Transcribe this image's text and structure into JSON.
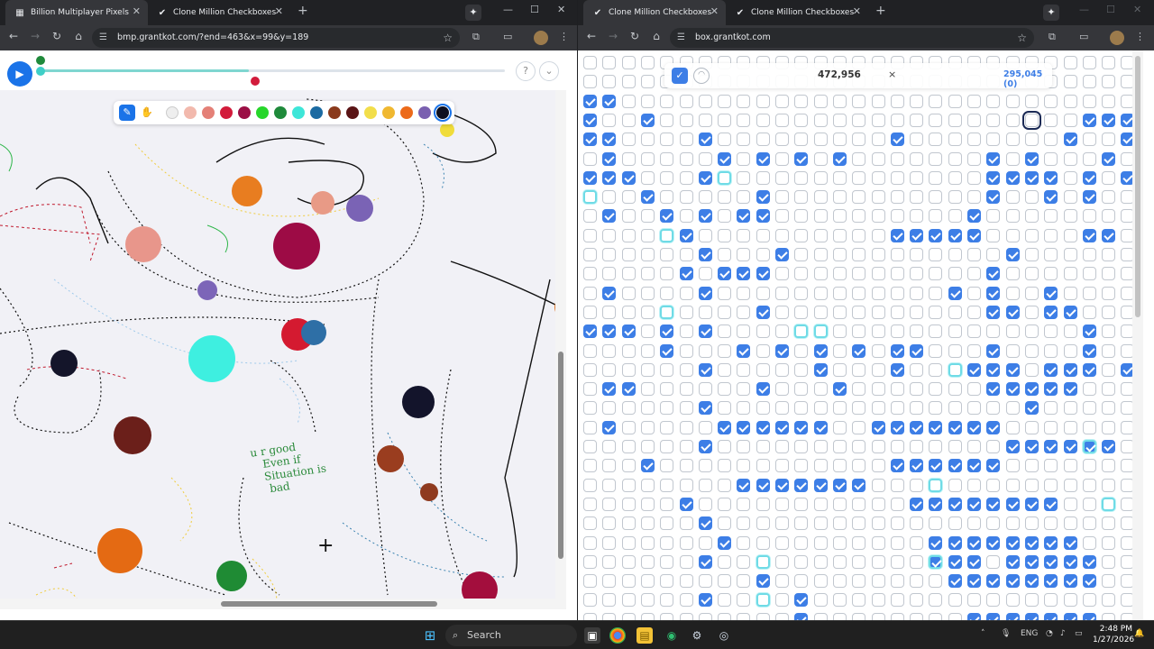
{
  "left_window": {
    "tabs": [
      {
        "label": "Billion Multiplayer Pixels",
        "active": true
      },
      {
        "label": "Clone Million Checkboxes",
        "active": false
      }
    ],
    "url": "bmp.grantkot.com/?end=463&x=99&y=189",
    "timeline_progress": 0.45,
    "palette": {
      "tools": [
        "pencil-icon",
        "hand-icon"
      ],
      "colors": [
        "#eeeeee",
        "#f2b9ad",
        "#e48077",
        "#d21b3b",
        "#9b0f45",
        "#27d62b",
        "#1f8a3b",
        "#3ee6d8",
        "#1b6aa2",
        "#8a3a1c",
        "#5a1416",
        "#f2de4b",
        "#f0b830",
        "#ec6a1a",
        "#7a60b0",
        "#0e0f1e"
      ],
      "selected_index": 15
    },
    "canvas": {
      "blobs": [
        {
          "color": "#f0dc3a",
          "note": "yellow"
        },
        {
          "color": "#e87d20"
        },
        {
          "color": "#e89a86"
        },
        {
          "color": "#7a63b5"
        },
        {
          "color": "#9d0b45"
        },
        {
          "color": "#e8968b"
        },
        {
          "color": "#7c65b8"
        },
        {
          "color": "#d41a30"
        },
        {
          "color": "#2e6fa6"
        },
        {
          "color": "#3eefe0"
        },
        {
          "color": "#14152a"
        },
        {
          "color": "#13142b"
        },
        {
          "color": "#6b1f1a"
        },
        {
          "color": "#9a3d1f"
        },
        {
          "color": "#8f3a1f"
        },
        {
          "color": "#e46a13"
        },
        {
          "color": "#1f8b34"
        },
        {
          "color": "#a30e3d"
        },
        {
          "color": "#e17a2c"
        }
      ],
      "graffiti": [
        "u r good",
        "Even if",
        "Situation is",
        "bad"
      ]
    }
  },
  "right_window": {
    "tabs": [
      {
        "label": "Clone Million Checkboxes",
        "active": true
      },
      {
        "label": "Clone Million Checkboxes",
        "active": false
      }
    ],
    "url": "box.grantkot.com",
    "count": "472,956",
    "close_label": "×",
    "score": "295,045 (0)",
    "grid": {
      "cols": 29,
      "rows": 31,
      "checked": [
        [
          6,
          28
        ],
        [
          2,
          0
        ],
        [
          2,
          1
        ],
        [
          3,
          0
        ],
        [
          3,
          3
        ],
        [
          3,
          26
        ],
        [
          3,
          27
        ],
        [
          3,
          28
        ],
        [
          4,
          0
        ],
        [
          4,
          1
        ],
        [
          4,
          6
        ],
        [
          4,
          16
        ],
        [
          4,
          25
        ],
        [
          4,
          28
        ],
        [
          5,
          1
        ],
        [
          5,
          7
        ],
        [
          5,
          9
        ],
        [
          5,
          11
        ],
        [
          5,
          13
        ],
        [
          5,
          21
        ],
        [
          5,
          23
        ],
        [
          5,
          27
        ],
        [
          6,
          0
        ],
        [
          6,
          1
        ],
        [
          6,
          2
        ],
        [
          6,
          6
        ],
        [
          6,
          21
        ],
        [
          6,
          22
        ],
        [
          6,
          23
        ],
        [
          6,
          24
        ],
        [
          6,
          26
        ],
        [
          7,
          3
        ],
        [
          7,
          9
        ],
        [
          7,
          21
        ],
        [
          7,
          24
        ],
        [
          7,
          26
        ],
        [
          8,
          1
        ],
        [
          8,
          4
        ],
        [
          8,
          6
        ],
        [
          8,
          8
        ],
        [
          8,
          9
        ],
        [
          8,
          20
        ],
        [
          9,
          5
        ],
        [
          9,
          16
        ],
        [
          9,
          17
        ],
        [
          9,
          18
        ],
        [
          9,
          19
        ],
        [
          9,
          20
        ],
        [
          9,
          26
        ],
        [
          9,
          27
        ],
        [
          10,
          6
        ],
        [
          10,
          10
        ],
        [
          10,
          22
        ],
        [
          11,
          5
        ],
        [
          11,
          7
        ],
        [
          11,
          8
        ],
        [
          11,
          9
        ],
        [
          11,
          21
        ],
        [
          12,
          1
        ],
        [
          12,
          6
        ],
        [
          12,
          19
        ],
        [
          12,
          21
        ],
        [
          12,
          24
        ],
        [
          13,
          9
        ],
        [
          13,
          21
        ],
        [
          13,
          22
        ],
        [
          13,
          24
        ],
        [
          13,
          25
        ],
        [
          14,
          0
        ],
        [
          14,
          1
        ],
        [
          14,
          2
        ],
        [
          14,
          4
        ],
        [
          14,
          6
        ],
        [
          14,
          26
        ],
        [
          15,
          4
        ],
        [
          15,
          8
        ],
        [
          15,
          10
        ],
        [
          15,
          12
        ],
        [
          15,
          14
        ],
        [
          15,
          16
        ],
        [
          15,
          17
        ],
        [
          15,
          21
        ],
        [
          15,
          26
        ],
        [
          16,
          6
        ],
        [
          16,
          12
        ],
        [
          16,
          16
        ],
        [
          16,
          20
        ],
        [
          16,
          21
        ],
        [
          16,
          22
        ],
        [
          16,
          24
        ],
        [
          16,
          25
        ],
        [
          16,
          26
        ],
        [
          16,
          28
        ],
        [
          17,
          1
        ],
        [
          17,
          2
        ],
        [
          17,
          9
        ],
        [
          17,
          13
        ],
        [
          17,
          21
        ],
        [
          17,
          22
        ],
        [
          17,
          23
        ],
        [
          17,
          24
        ],
        [
          17,
          25
        ],
        [
          18,
          6
        ],
        [
          18,
          23
        ],
        [
          19,
          1
        ],
        [
          19,
          7
        ],
        [
          19,
          8
        ],
        [
          19,
          9
        ],
        [
          19,
          10
        ],
        [
          19,
          11
        ],
        [
          19,
          12
        ],
        [
          19,
          15
        ],
        [
          19,
          16
        ],
        [
          19,
          17
        ],
        [
          19,
          18
        ],
        [
          19,
          19
        ],
        [
          19,
          20
        ],
        [
          19,
          21
        ],
        [
          20,
          6
        ],
        [
          20,
          22
        ],
        [
          20,
          23
        ],
        [
          20,
          24
        ],
        [
          20,
          25
        ],
        [
          20,
          26
        ],
        [
          20,
          27
        ],
        [
          21,
          3
        ],
        [
          21,
          16
        ],
        [
          21,
          17
        ],
        [
          21,
          18
        ],
        [
          21,
          19
        ],
        [
          21,
          20
        ],
        [
          21,
          21
        ],
        [
          22,
          8
        ],
        [
          22,
          9
        ],
        [
          22,
          10
        ],
        [
          22,
          11
        ],
        [
          22,
          12
        ],
        [
          22,
          13
        ],
        [
          22,
          14
        ],
        [
          23,
          5
        ],
        [
          23,
          17
        ],
        [
          23,
          18
        ],
        [
          23,
          19
        ],
        [
          23,
          20
        ],
        [
          23,
          21
        ],
        [
          23,
          22
        ],
        [
          23,
          23
        ],
        [
          23,
          24
        ],
        [
          24,
          6
        ],
        [
          25,
          7
        ],
        [
          25,
          18
        ],
        [
          25,
          19
        ],
        [
          25,
          20
        ],
        [
          25,
          21
        ],
        [
          25,
          22
        ],
        [
          25,
          23
        ],
        [
          25,
          24
        ],
        [
          25,
          25
        ],
        [
          26,
          6
        ],
        [
          26,
          18
        ],
        [
          26,
          19
        ],
        [
          26,
          20
        ],
        [
          26,
          22
        ],
        [
          26,
          23
        ],
        [
          26,
          24
        ],
        [
          26,
          25
        ],
        [
          26,
          26
        ],
        [
          27,
          9
        ],
        [
          27,
          19
        ],
        [
          27,
          20
        ],
        [
          27,
          21
        ],
        [
          27,
          22
        ],
        [
          27,
          23
        ],
        [
          27,
          24
        ],
        [
          27,
          25
        ],
        [
          27,
          26
        ],
        [
          28,
          6
        ],
        [
          28,
          11
        ],
        [
          29,
          11
        ],
        [
          29,
          20
        ],
        [
          29,
          21
        ],
        [
          29,
          22
        ],
        [
          29,
          23
        ],
        [
          29,
          24
        ],
        [
          29,
          25
        ],
        [
          29,
          26
        ],
        [
          30,
          6
        ]
      ],
      "highlighted": [
        [
          6,
          7
        ],
        [
          7,
          0
        ],
        [
          9,
          4
        ],
        [
          13,
          4
        ],
        [
          14,
          11
        ],
        [
          14,
          12
        ],
        [
          16,
          19
        ],
        [
          20,
          26
        ],
        [
          22,
          18
        ],
        [
          23,
          27
        ],
        [
          26,
          9
        ],
        [
          26,
          18
        ],
        [
          28,
          9
        ]
      ],
      "cursor": [
        3,
        23
      ]
    }
  },
  "taskbar": {
    "search_placeholder": "Search",
    "language": "ENG",
    "time": "2:48 PM",
    "date": "1/27/2026"
  }
}
